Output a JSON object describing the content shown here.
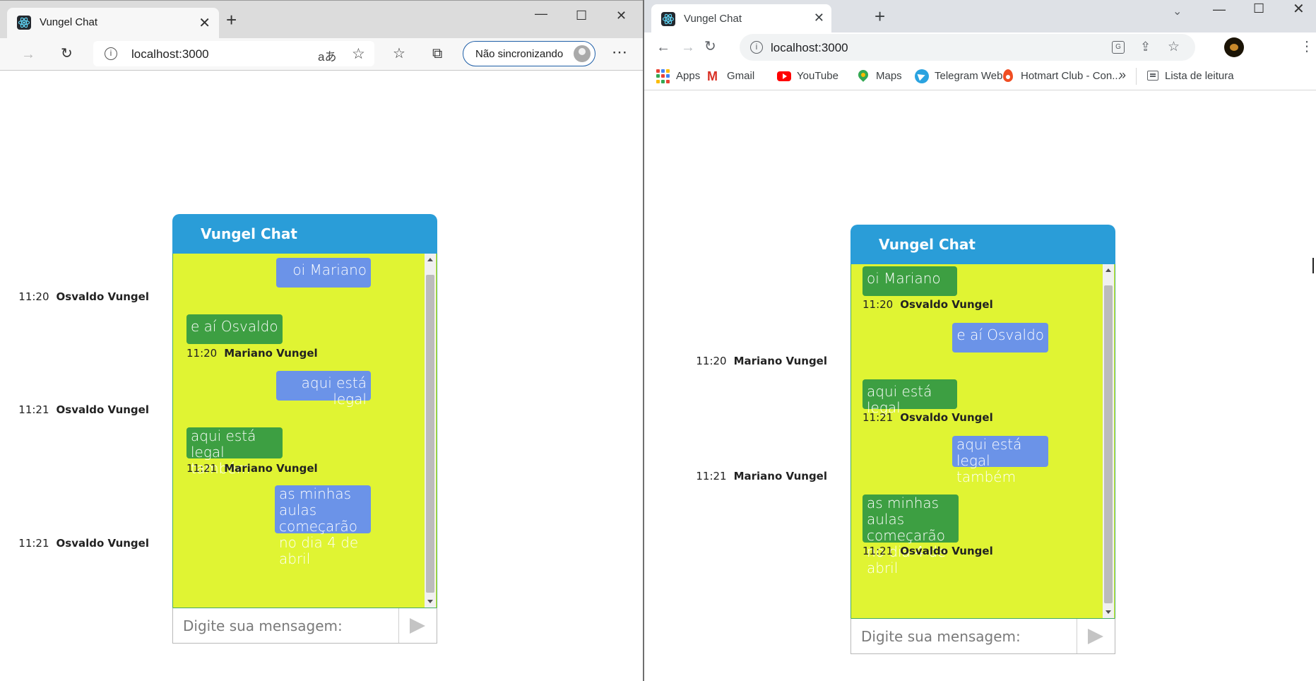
{
  "edge": {
    "tab_title": "Vungel Chat",
    "url": "localhost:3000",
    "sync_label": "Não sincronizando"
  },
  "chrome": {
    "tab_title": "Vungel Chat",
    "url": "localhost:3000",
    "bookmarks": [
      {
        "label": "Apps",
        "icon": "apps-icon"
      },
      {
        "label": "Gmail",
        "icon": "gmail-icon"
      },
      {
        "label": "YouTube",
        "icon": "youtube-icon"
      },
      {
        "label": "Maps",
        "icon": "maps-icon"
      },
      {
        "label": "Telegram Web",
        "icon": "telegram-icon"
      },
      {
        "label": "Hotmart Club - Con...",
        "icon": "hotmart-icon"
      }
    ],
    "bookmarks_more": "»",
    "reading_list": "Lista de leitura"
  },
  "glyphs": {
    "tab_close": "✕",
    "new_tab": "+",
    "minimize": "—",
    "maximize": "☐",
    "window_close": "✕",
    "back": "←",
    "forward": "→",
    "reload": "↻",
    "info": "i",
    "read_aloud": "aあ",
    "favorites_add": "☆",
    "favorites": "☆",
    "collections": "⧉",
    "more": "⋯",
    "chevron_down": "⌄",
    "share": "⇪",
    "star": "☆",
    "kebab": "⋮",
    "gmail": "M",
    "translate": "G"
  },
  "colors": {
    "chat_header": "#2a9dd8",
    "chat_background": "#e0f433",
    "bubble_blue": "#6b93e8",
    "bubble_green": "#3d9f42"
  },
  "chat": {
    "title": "Vungel Chat",
    "input_placeholder": "Digite sua mensagem:"
  },
  "edge_messages": [
    {
      "text": "oi Mariano",
      "time": "11:20",
      "author": "Osvaldo Vungel",
      "side": "right"
    },
    {
      "text": "e aí Osvaldo",
      "time": "11:20",
      "author": "Mariano Vungel",
      "side": "left"
    },
    {
      "text": "aqui está legal",
      "time": "11:21",
      "author": "Osvaldo Vungel",
      "side": "right"
    },
    {
      "text": "aqui está legal também",
      "time": "11:21",
      "author": "Mariano Vungel",
      "side": "left"
    },
    {
      "text": "as minhas aulas começarão no dia 4 de abril",
      "time": "11:21",
      "author": "Osvaldo Vungel",
      "side": "right"
    }
  ],
  "chrome_messages": [
    {
      "text": "oi Mariano",
      "time": "11:20",
      "author": "Osvaldo Vungel",
      "side": "left"
    },
    {
      "text": "e aí Osvaldo",
      "time": "11:20",
      "author": "Mariano Vungel",
      "side": "right"
    },
    {
      "text": "aqui está legal",
      "time": "11:21",
      "author": "Osvaldo Vungel",
      "side": "left"
    },
    {
      "text": "aqui está legal também",
      "time": "11:21",
      "author": "Mariano Vungel",
      "side": "right"
    },
    {
      "text": "as minhas aulas começarão no dia 4 de abril",
      "time": "11:21",
      "author": "Osvaldo Vungel",
      "side": "left"
    }
  ]
}
